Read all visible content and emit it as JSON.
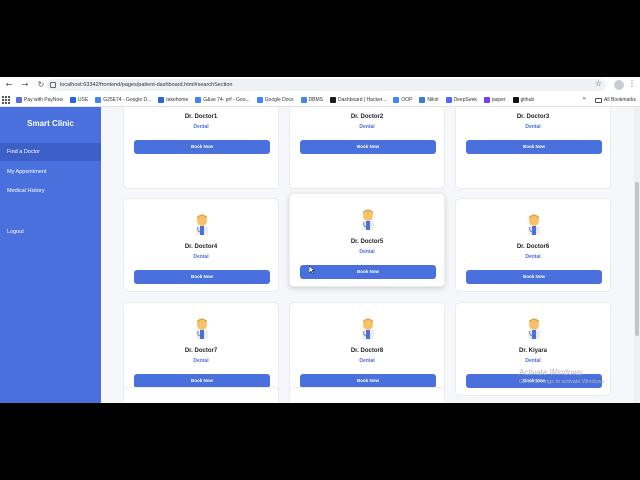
{
  "browser": {
    "url": "localhost:63342/frontend/pages/patient-dashboard.html#searchSection",
    "back_icon": "arrow-left-icon",
    "forward_icon": "arrow-right-icon",
    "reload_icon": "reload-icon",
    "bookmark_star_icon": "star-icon"
  },
  "bookmarks": {
    "items": [
      {
        "label": "Pay with PayNow",
        "color": "#5b6ee1"
      },
      {
        "label": "USE",
        "color": "#2a66d9"
      },
      {
        "label": "G25E74 - Google D...",
        "color": "#4285f4"
      },
      {
        "label": "takehome",
        "color": "#2a66d9"
      },
      {
        "label": "G&se 74- prf - Goo...",
        "color": "#4285f4"
      },
      {
        "label": "Google Docs",
        "color": "#4285f4"
      },
      {
        "label": "DBMS",
        "color": "#4285f4"
      },
      {
        "label": "Dashboard | Hacker...",
        "color": "#1a1a1a"
      },
      {
        "label": "OOP",
        "color": "#4285f4"
      },
      {
        "label": "Nikiri",
        "color": "#3a7bd5"
      },
      {
        "label": "DeepSeek",
        "color": "#4d6bfe"
      },
      {
        "label": "jasper",
        "color": "#7b3fe4"
      },
      {
        "label": "github",
        "color": "#111111"
      }
    ],
    "more": "»",
    "all": "All Bookmarks"
  },
  "sidebar": {
    "brand": "Smart Clinic",
    "items": [
      {
        "label": "Find a Doctor"
      },
      {
        "label": "My Appointment"
      },
      {
        "label": "Medical History"
      },
      {
        "label": "Logout"
      }
    ]
  },
  "doctors": [
    {
      "name": "Dr. Doctor1",
      "specialty": "Dental",
      "button": "Book Now"
    },
    {
      "name": "Dr. Doctor2",
      "specialty": "Dental",
      "button": "Book Now"
    },
    {
      "name": "Dr. Doctor3",
      "specialty": "Dental",
      "button": "Book Now"
    },
    {
      "name": "Dr. Doctor4",
      "specialty": "Dental",
      "button": "Book Now"
    },
    {
      "name": "Dr. Doctor5",
      "specialty": "Dental",
      "button": "Book Now"
    },
    {
      "name": "Dr. Doctor6",
      "specialty": "Dental",
      "button": "Book Now"
    },
    {
      "name": "Dr. Doctor7",
      "specialty": "Dental",
      "button": "Book Now"
    },
    {
      "name": "Dr. Doctor8",
      "specialty": "Dental",
      "button": "Book Now"
    },
    {
      "name": "Dr. Kiyara",
      "specialty": "Dental",
      "button": "Book Now"
    }
  ],
  "watermark": {
    "title": "Activate Windows",
    "subtitle": "Go to Settings to activate Windows."
  },
  "colors": {
    "accent": "#4a70de",
    "sidebar_active": "#3d5fc8"
  }
}
